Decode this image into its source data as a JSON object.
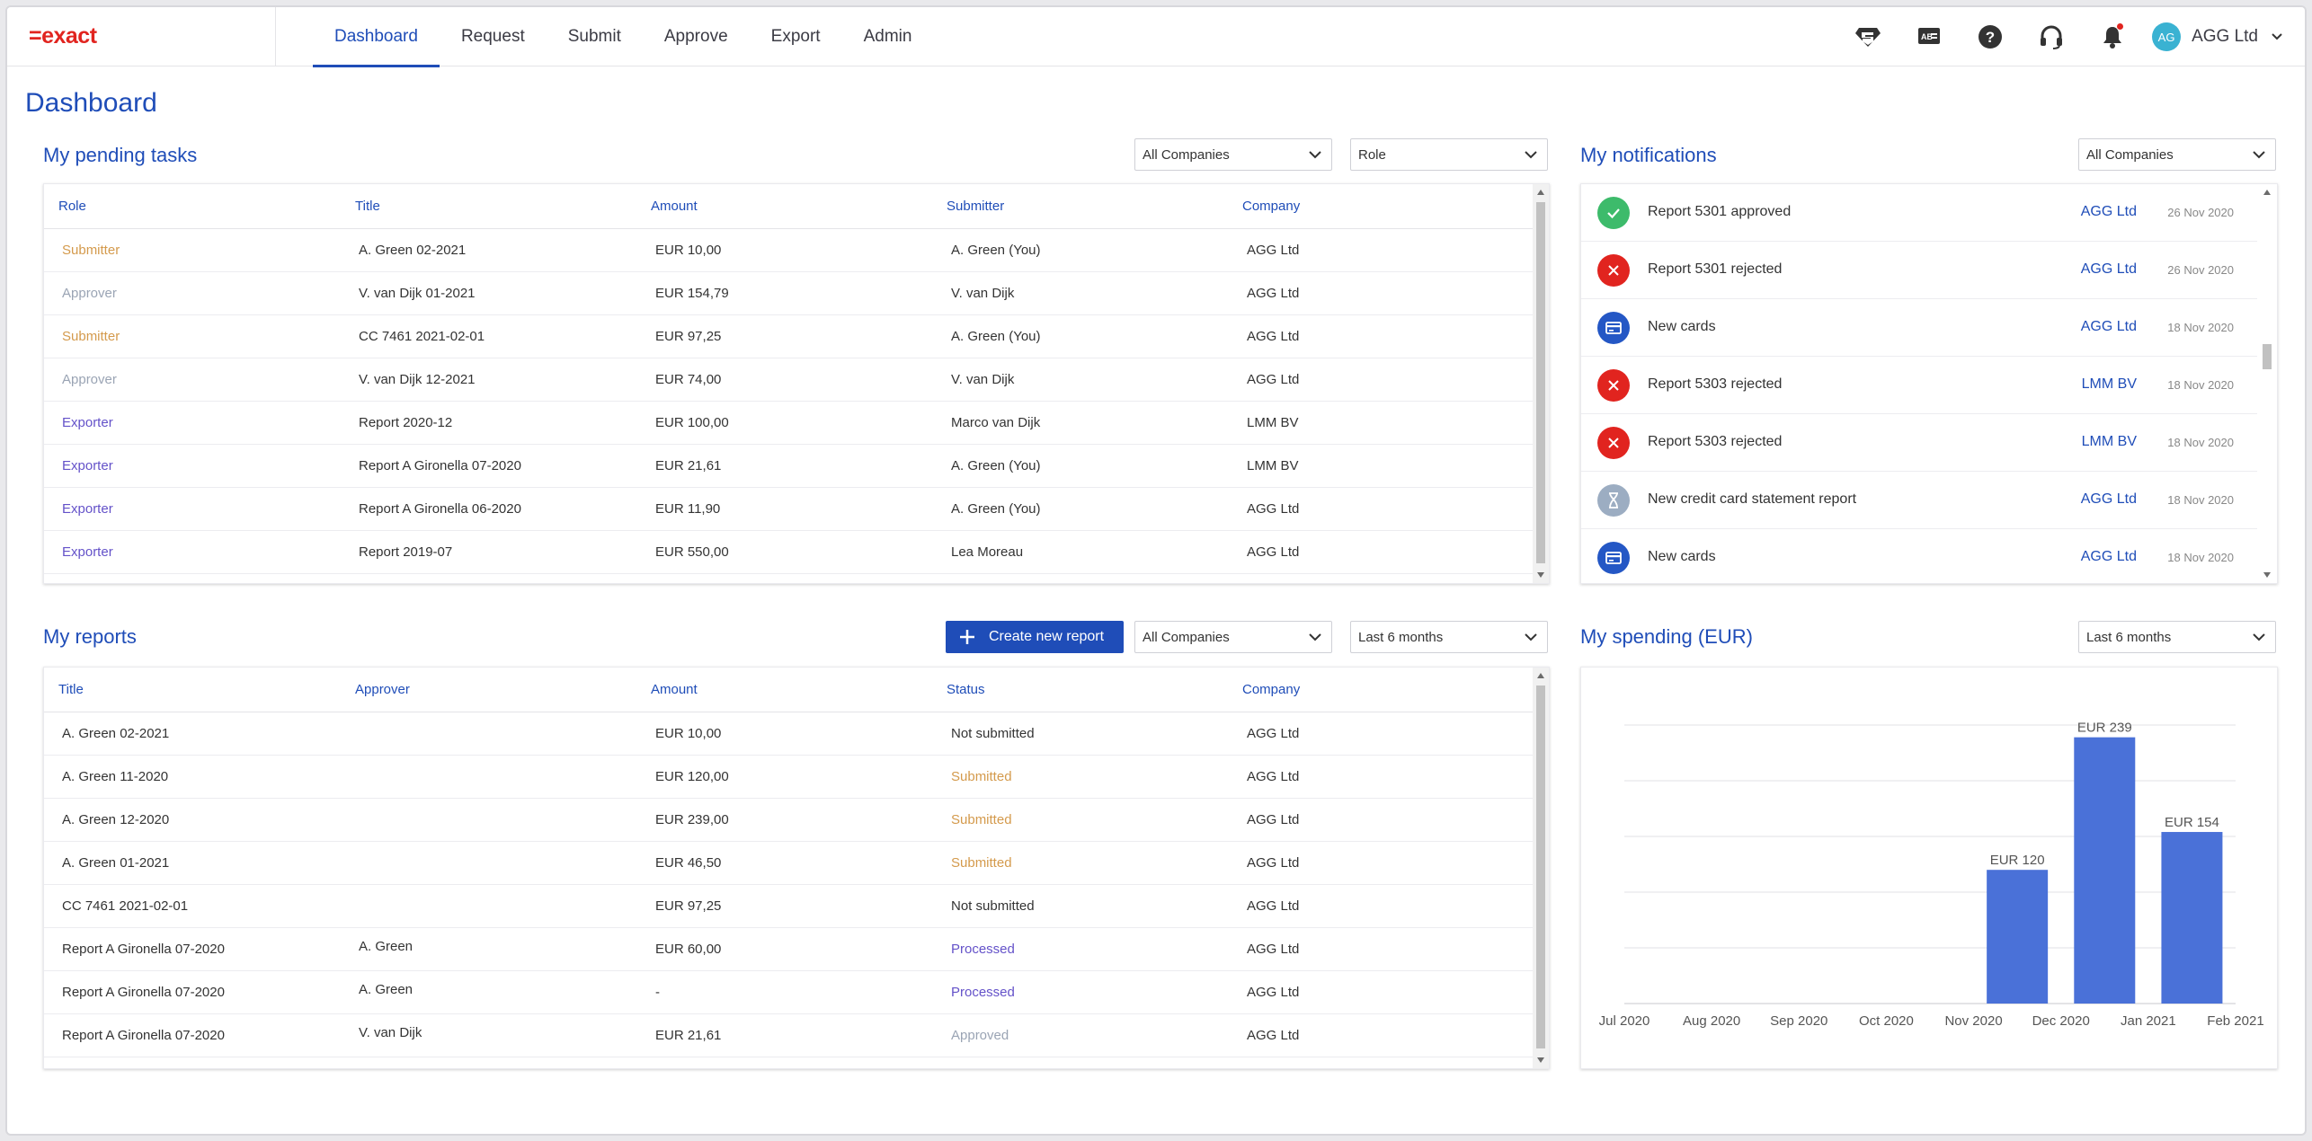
{
  "brand": "=exact",
  "nav": {
    "items": [
      "Dashboard",
      "Request",
      "Submit",
      "Approve",
      "Export",
      "Admin"
    ],
    "active": "Dashboard"
  },
  "user": {
    "initials": "AG",
    "name": "AGG Ltd"
  },
  "page": {
    "title": "Dashboard"
  },
  "pending": {
    "title": "My pending tasks",
    "company_filter": "All Companies",
    "role_filter": "Role",
    "columns": [
      "Role",
      "Title",
      "Amount",
      "Submitter",
      "Company"
    ],
    "rows": [
      {
        "role": "Submitter",
        "title": "A. Green 02-2021",
        "amount": "EUR 10,00",
        "submitter": "A. Green (You)",
        "company": "AGG Ltd"
      },
      {
        "role": "Approver",
        "title": "V. van Dijk 01-2021",
        "amount": "EUR 154,79",
        "submitter": "V. van Dijk",
        "company": "AGG Ltd"
      },
      {
        "role": "Submitter",
        "title": "CC 7461 2021-02-01",
        "amount": "EUR 97,25",
        "submitter": "A. Green (You)",
        "company": "AGG Ltd"
      },
      {
        "role": "Approver",
        "title": "V. van Dijk 12-2021",
        "amount": "EUR 74,00",
        "submitter": "V. van Dijk",
        "company": "AGG Ltd"
      },
      {
        "role": "Exporter",
        "title": "Report 2020-12",
        "amount": "EUR 100,00",
        "submitter": "Marco van Dijk",
        "company": "LMM BV"
      },
      {
        "role": "Exporter",
        "title": "Report A Gironella 07-2020",
        "amount": "EUR 21,61",
        "submitter": "A. Green (You)",
        "company": "LMM BV"
      },
      {
        "role": "Exporter",
        "title": "Report A Gironella 06-2020",
        "amount": "EUR 11,90",
        "submitter": "A. Green (You)",
        "company": "AGG Ltd"
      },
      {
        "role": "Exporter",
        "title": "Report 2019-07",
        "amount": "EUR 550,00",
        "submitter": "Lea Moreau",
        "company": "AGG Ltd"
      }
    ]
  },
  "notifications": {
    "title": "My notifications",
    "company_filter": "All Companies",
    "items": [
      {
        "icon": "approved-icon",
        "text": "Report 5301 approved",
        "company": "AGG Ltd",
        "date": "26 Nov 2020"
      },
      {
        "icon": "rejected-icon",
        "text": "Report 5301 rejected",
        "company": "AGG Ltd",
        "date": "26 Nov 2020"
      },
      {
        "icon": "card-icon",
        "text": "New cards",
        "company": "AGG Ltd",
        "date": "18 Nov 2020"
      },
      {
        "icon": "rejected-icon",
        "text": "Report 5303 rejected",
        "company": "LMM BV",
        "date": "18 Nov 2020"
      },
      {
        "icon": "rejected-icon",
        "text": "Report 5303 rejected",
        "company": "LMM BV",
        "date": "18 Nov 2020"
      },
      {
        "icon": "hourglass-icon",
        "text": "New credit card statement report",
        "company": "AGG Ltd",
        "date": "18 Nov 2020"
      },
      {
        "icon": "card-icon",
        "text": "New cards",
        "company": "AGG Ltd",
        "date": "18 Nov 2020"
      }
    ]
  },
  "reports": {
    "title": "My reports",
    "create_label": "Create new report",
    "company_filter": "All Companies",
    "period_filter": "Last 6 months",
    "columns": [
      "Title",
      "Approver",
      "Amount",
      "Status",
      "Company"
    ],
    "rows": [
      {
        "title": "A. Green 02-2021",
        "approver": "",
        "amount": "EUR 10,00",
        "status": "Not submitted",
        "company": "AGG Ltd"
      },
      {
        "title": "A. Green 11-2020",
        "approver": "",
        "amount": "EUR 120,00",
        "status": "Submitted",
        "company": "AGG Ltd"
      },
      {
        "title": "A. Green 12-2020",
        "approver": "",
        "amount": "EUR 239,00",
        "status": "Submitted",
        "company": "AGG Ltd"
      },
      {
        "title": "A. Green 01-2021",
        "approver": "",
        "amount": "EUR 46,50",
        "status": "Submitted",
        "company": "AGG Ltd"
      },
      {
        "title": "CC 7461 2021-02-01",
        "approver": "",
        "amount": "EUR 97,25",
        "status": "Not submitted",
        "company": "AGG Ltd"
      },
      {
        "title": "Report A Gironella 07-2020",
        "approver": "A. Green",
        "amount": "EUR 60,00",
        "status": "Processed",
        "company": "AGG Ltd"
      },
      {
        "title": "Report A Gironella 07-2020",
        "approver": "A. Green",
        "amount": "-",
        "status": "Processed",
        "company": "AGG Ltd"
      },
      {
        "title": "Report A Gironella 07-2020",
        "approver": "V. van Dijk",
        "amount": "EUR 21,61",
        "status": "Approved",
        "company": "AGG Ltd"
      }
    ]
  },
  "spending": {
    "title": "My spending (EUR)",
    "period_filter": "Last 6 months"
  },
  "colors": {
    "accent": "#1f4db8",
    "bar": "#4a71d8",
    "brand": "#e1241f"
  },
  "chart_data": {
    "type": "bar",
    "categories": [
      "Jul 2020",
      "Aug 2020",
      "Sep 2020",
      "Oct 2020",
      "Nov 2020",
      "Dec 2020",
      "Jan 2021",
      "Feb 2021"
    ],
    "values": [
      0,
      0,
      0,
      0,
      120,
      239,
      154,
      0
    ],
    "data_labels": [
      "",
      "",
      "",
      "",
      "EUR 120",
      "EUR 239",
      "EUR 154",
      ""
    ],
    "title": "My spending (EUR)",
    "xlabel": "",
    "ylabel": "",
    "ylim": [
      0,
      250
    ],
    "grid": true,
    "legend": "none"
  }
}
